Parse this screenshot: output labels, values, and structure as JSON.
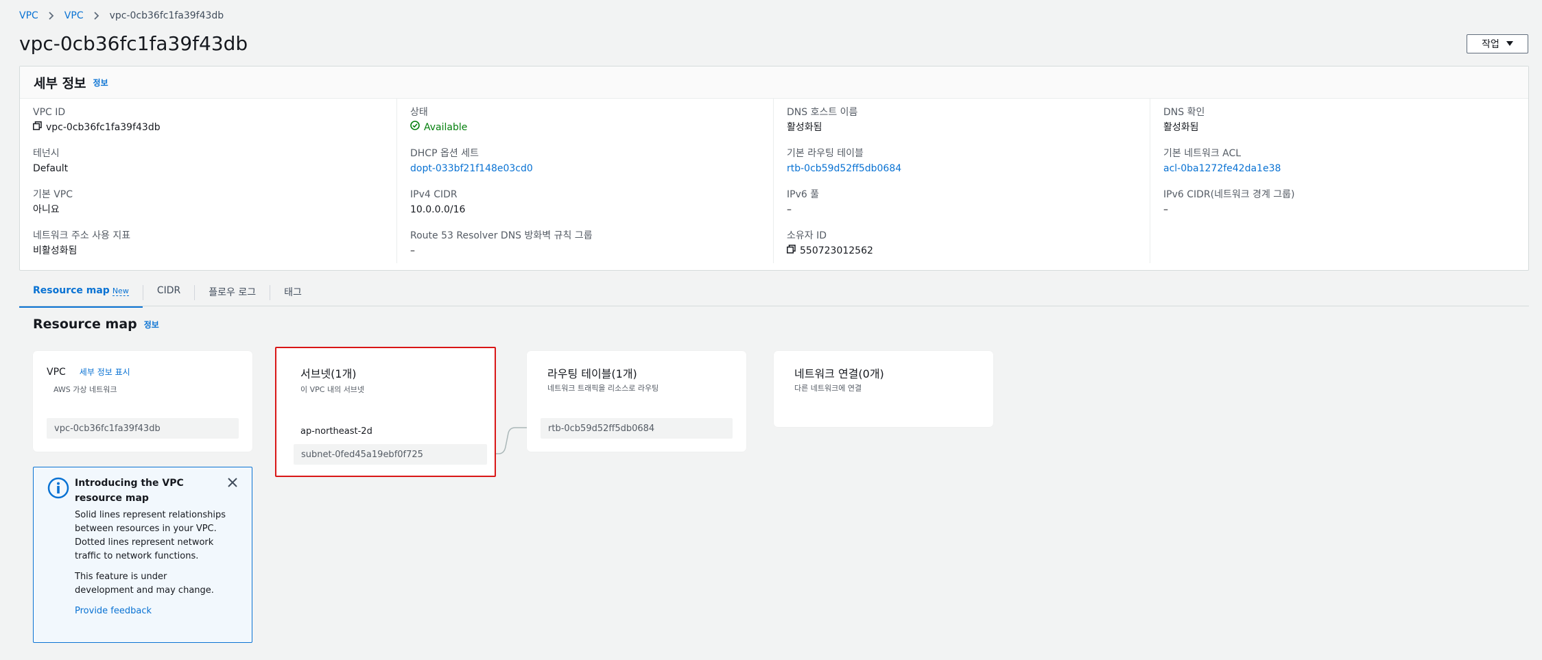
{
  "breadcrumb": {
    "items": [
      "VPC",
      "VPC"
    ],
    "current": "vpc-0cb36fc1fa39f43db"
  },
  "page": {
    "title": "vpc-0cb36fc1fa39f43db",
    "action_label": "작업"
  },
  "details": {
    "title": "세부 정보",
    "info": "정보",
    "col1": [
      {
        "label": "VPC ID",
        "value": "vpc-0cb36fc1fa39f43db"
      },
      {
        "label": "테넌시",
        "value": "Default"
      },
      {
        "label": "기본 VPC",
        "value": "아니요"
      },
      {
        "label": "네트워크 주소 사용 지표",
        "value": "비활성화됨"
      }
    ],
    "col2": [
      {
        "label": "상태",
        "value": "Available"
      },
      {
        "label": "DHCP 옵션 세트",
        "value": "dopt-033bf21f148e03cd0"
      },
      {
        "label": "IPv4 CIDR",
        "value": "10.0.0.0/16"
      },
      {
        "label": "Route 53 Resolver DNS 방화벽 규칙 그룹",
        "value": "–"
      }
    ],
    "col3": [
      {
        "label": "DNS 호스트 이름",
        "value": "활성화됨"
      },
      {
        "label": "기본 라우팅 테이블",
        "value": "rtb-0cb59d52ff5db0684"
      },
      {
        "label": "IPv6 풀",
        "value": "–"
      },
      {
        "label": "소유자 ID",
        "value": "550723012562"
      }
    ],
    "col4": [
      {
        "label": "DNS 확인",
        "value": "활성화됨"
      },
      {
        "label": "기본 네트워크 ACL",
        "value": "acl-0ba1272fe42da1e38"
      },
      {
        "label": "IPv6 CIDR(네트워크 경계 그룹)",
        "value": "–"
      }
    ]
  },
  "tabs": [
    {
      "label": "Resource map",
      "badge": "New"
    },
    {
      "label": "CIDR"
    },
    {
      "label": "플로우 로그"
    },
    {
      "label": "태그"
    }
  ],
  "resource_map": {
    "title": "Resource map",
    "info": "정보",
    "vpc_card": {
      "title": "VPC",
      "link": "세부 정보 표시",
      "subtitle": "AWS 가상 네트워크",
      "item": "vpc-0cb36fc1fa39f43db"
    },
    "subnet_card": {
      "title": "서브넷(1개)",
      "subtitle": "이 VPC 내의 서브넷",
      "az": "ap-northeast-2d",
      "item": "subnet-0fed45a19ebf0f725"
    },
    "route_card": {
      "title": "라우팅 테이블(1개)",
      "subtitle": "네트워크 트래픽을 리소스로 라우팅",
      "item": "rtb-0cb59d52ff5db0684"
    },
    "network_card": {
      "title": "네트워크 연결(0개)",
      "subtitle": "다른 네트워크에 연결"
    }
  },
  "flash": {
    "title": "Introducing the VPC resource map",
    "body1": "Solid lines represent relationships between resources in your VPC. Dotted lines represent network traffic to network functions.",
    "body2": "This feature is under development and may change.",
    "feedback": "Provide feedback"
  },
  "colors": {
    "link": "#0972d3",
    "success": "#037f0c",
    "highlight": "#d91515",
    "info_bg": "#f2f8fd"
  }
}
